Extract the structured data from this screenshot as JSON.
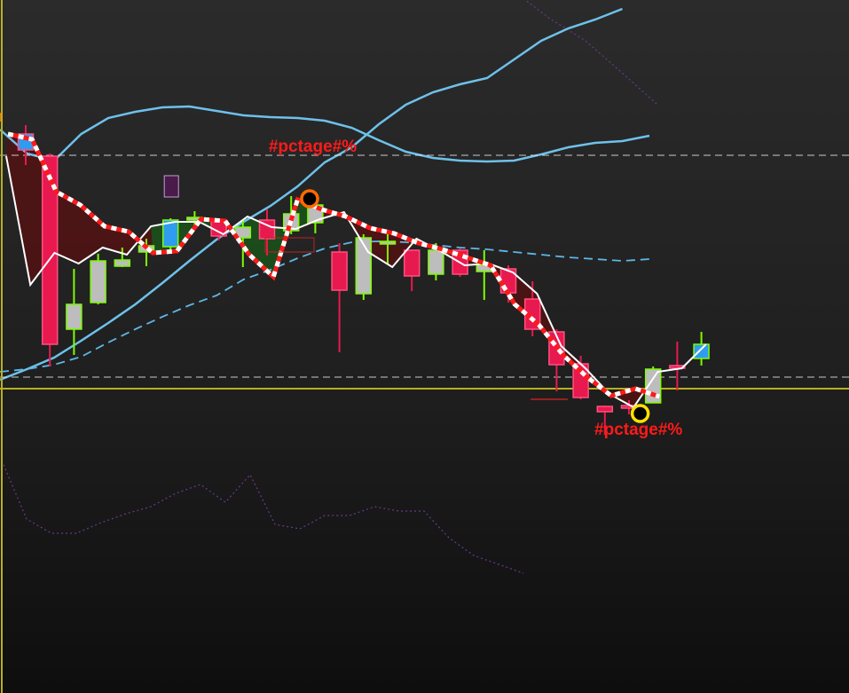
{
  "chart_data": {
    "type": "candlestick",
    "ylim": [
      0,
      781
    ],
    "grid": false,
    "colors": {
      "bull_body": "#bdbdbd",
      "bull_outline": "#7cfc00",
      "bear_body": "#e8194f",
      "doji_body": "#2f9cf0",
      "upper_band": "#6ec1ea",
      "mid_band": "#5fb6e6",
      "price_line": "#ffffff",
      "trend_red": "#ff1a1a",
      "fill_bear": "#5a1010",
      "fill_bull": "#1a5a1a",
      "level_line": "#b8b020",
      "dash_line": "#e8e8e8",
      "ring_orange": "#ff6a00",
      "ring_yellow": "#ffe000",
      "annotation": "#ff1a1a",
      "dotted": "#6a3a8a"
    },
    "candles": [
      {
        "x": 0,
        "o": 630,
        "h": 640,
        "l": 595,
        "c": 612
      },
      {
        "x": 1,
        "o": 605,
        "h": 608,
        "l": 368,
        "c": 393
      },
      {
        "x": 2,
        "o": 410,
        "h": 478,
        "l": 381,
        "c": 438
      },
      {
        "x": 3,
        "o": 440,
        "h": 495,
        "l": 438,
        "c": 487
      },
      {
        "x": 4,
        "o": 481,
        "h": 502,
        "l": 480,
        "c": 488
      },
      {
        "x": 5,
        "o": 497,
        "h": 512,
        "l": 481,
        "c": 504
      },
      {
        "x": 6,
        "o": 503,
        "h": 535,
        "l": 497,
        "c": 533
      },
      {
        "x": 7,
        "o": 534,
        "h": 543,
        "l": 522,
        "c": 536
      },
      {
        "x": 8,
        "o": 531,
        "h": 530,
        "l": 510,
        "c": 515
      },
      {
        "x": 9,
        "o": 513,
        "h": 533,
        "l": 480,
        "c": 525
      },
      {
        "x": 10,
        "o": 533,
        "h": 545,
        "l": 493,
        "c": 512
      },
      {
        "x": 11,
        "o": 521,
        "h": 560,
        "l": 517,
        "c": 540
      },
      {
        "x": 12,
        "o": 530,
        "h": 550,
        "l": 518,
        "c": 550
      },
      {
        "x": 13,
        "o": 497,
        "h": 507,
        "l": 384,
        "c": 454
      },
      {
        "x": 14,
        "o": 450,
        "h": 517,
        "l": 443,
        "c": 513
      },
      {
        "x": 15,
        "o": 509,
        "h": 518,
        "l": 483,
        "c": 509
      },
      {
        "x": 16,
        "o": 499,
        "h": 499,
        "l": 453,
        "c": 470
      },
      {
        "x": 17,
        "o": 472,
        "h": 507,
        "l": 465,
        "c": 499
      },
      {
        "x": 18,
        "o": 499,
        "h": 501,
        "l": 469,
        "c": 472
      },
      {
        "x": 19,
        "o": 475,
        "h": 499,
        "l": 443,
        "c": 482
      },
      {
        "x": 20,
        "o": 478,
        "h": 482,
        "l": 440,
        "c": 451
      },
      {
        "x": 21,
        "o": 444,
        "h": 464,
        "l": 402,
        "c": 410
      },
      {
        "x": 22,
        "o": 407,
        "h": 410,
        "l": 340,
        "c": 370
      },
      {
        "x": 23,
        "o": 371,
        "h": 380,
        "l": 331,
        "c": 333
      },
      {
        "x": 24,
        "o": 323,
        "h": 324,
        "l": 291,
        "c": 317
      },
      {
        "x": 25,
        "o": 324,
        "h": 330,
        "l": 314,
        "c": 323
      },
      {
        "x": 26,
        "o": 327,
        "h": 368,
        "l": 327,
        "c": 365
      },
      {
        "x": 27,
        "o": 369,
        "h": 396,
        "l": 341,
        "c": 367
      },
      {
        "x": 28,
        "o": 377,
        "h": 407,
        "l": 369,
        "c": 393
      }
    ],
    "series": [
      {
        "values": [
          [
            0,
            635
          ],
          [
            1,
            608
          ],
          [
            2,
            600
          ],
          [
            3,
            630
          ],
          [
            4,
            648
          ],
          [
            5,
            655
          ],
          [
            6,
            660
          ],
          [
            7,
            661
          ],
          [
            8,
            656
          ],
          [
            9,
            651
          ],
          [
            10,
            649
          ],
          [
            11,
            648
          ],
          [
            12,
            645
          ],
          [
            13,
            637
          ],
          [
            14,
            623
          ],
          [
            15,
            610
          ],
          [
            16,
            603
          ],
          [
            17,
            600
          ],
          [
            18,
            599
          ],
          [
            19,
            600
          ],
          [
            20,
            607
          ],
          [
            21,
            615
          ],
          [
            22,
            620
          ],
          [
            23,
            622
          ],
          [
            24,
            628
          ]
        ]
      },
      {
        "values": [
          [
            0,
            353
          ],
          [
            1,
            365
          ],
          [
            2,
            378
          ],
          [
            3,
            397
          ],
          [
            4,
            417
          ],
          [
            5,
            438
          ],
          [
            6,
            462
          ],
          [
            7,
            487
          ],
          [
            8,
            511
          ],
          [
            9,
            531
          ],
          [
            10,
            549
          ],
          [
            11,
            571
          ],
          [
            12,
            598
          ],
          [
            13,
            615
          ],
          [
            14,
            641
          ],
          [
            15,
            663
          ],
          [
            16,
            677
          ],
          [
            17,
            686
          ],
          [
            18,
            693
          ],
          [
            19,
            714
          ],
          [
            20,
            735
          ],
          [
            21,
            749
          ],
          [
            22,
            759
          ],
          [
            23,
            771
          ]
        ]
      },
      {
        "values": [
          [
            0,
            362
          ],
          [
            1,
            365
          ],
          [
            2,
            370
          ],
          [
            3,
            379
          ],
          [
            4,
            395
          ],
          [
            5,
            410
          ],
          [
            6,
            424
          ],
          [
            7,
            437
          ],
          [
            8,
            448
          ],
          [
            9,
            466
          ],
          [
            10,
            477
          ],
          [
            11,
            490
          ],
          [
            12,
            501
          ],
          [
            13,
            508
          ],
          [
            14,
            509
          ],
          [
            15,
            508
          ],
          [
            16,
            505
          ],
          [
            17,
            502
          ],
          [
            18,
            500
          ],
          [
            19,
            497
          ],
          [
            20,
            494
          ],
          [
            21,
            491
          ],
          [
            22,
            489
          ]
        ]
      },
      {
        "values": [
          [
            0,
            605
          ],
          [
            1,
            460
          ],
          [
            2,
            496
          ],
          [
            3,
            484
          ],
          [
            4,
            502
          ],
          [
            5,
            494
          ],
          [
            6,
            526
          ],
          [
            7,
            531
          ],
          [
            8,
            531
          ],
          [
            9,
            517
          ],
          [
            10,
            537
          ],
          [
            11,
            525
          ],
          [
            12,
            523
          ],
          [
            13,
            534
          ],
          [
            14,
            542
          ],
          [
            15,
            497
          ],
          [
            16,
            480
          ],
          [
            17,
            512
          ],
          [
            18,
            498
          ],
          [
            19,
            482
          ],
          [
            20,
            484
          ],
          [
            21,
            474
          ],
          [
            22,
            450
          ],
          [
            23,
            391
          ],
          [
            24,
            366
          ],
          [
            25,
            337
          ],
          [
            26,
            322
          ],
          [
            27,
            362
          ],
          [
            28,
            366
          ],
          [
            29,
            393
          ]
        ]
      },
      {
        "values": [
          [
            0,
            630
          ],
          [
            1,
            624
          ],
          [
            2,
            565
          ],
          [
            3,
            550
          ],
          [
            4,
            526
          ],
          [
            5,
            520
          ],
          [
            6,
            496
          ],
          [
            7,
            498
          ],
          [
            8,
            534
          ],
          [
            9,
            532
          ],
          [
            10,
            494
          ],
          [
            11,
            469
          ],
          [
            12,
            556
          ],
          [
            13,
            545
          ],
          [
            14,
            537
          ],
          [
            15,
            524
          ],
          [
            16,
            518
          ],
          [
            17,
            507
          ],
          [
            18,
            500
          ],
          [
            19,
            491
          ],
          [
            20,
            482
          ],
          [
            21,
            438
          ],
          [
            22,
            415
          ],
          [
            23,
            381
          ],
          [
            24,
            356
          ],
          [
            25,
            335
          ],
          [
            26,
            343
          ],
          [
            27,
            334
          ]
        ]
      }
    ],
    "horizontal_lines": [
      {
        "style": "dashed",
        "y": 606
      },
      {
        "style": "dashed",
        "y": 356
      },
      {
        "style": "solid",
        "y": 343
      }
    ],
    "markers": [
      {
        "type": "ring",
        "color": "orange",
        "x": 12.5,
        "y": 557
      },
      {
        "type": "ring",
        "color": "yellow",
        "x": 26.2,
        "y": 315
      },
      {
        "type": "box",
        "x": 6,
        "y": 583
      }
    ],
    "annotations": [
      {
        "text": "#pctage#%",
        "x": 12.2,
        "y": 610
      },
      {
        "text": "#pctage#%",
        "x": 25.7,
        "y": 291
      }
    ]
  }
}
